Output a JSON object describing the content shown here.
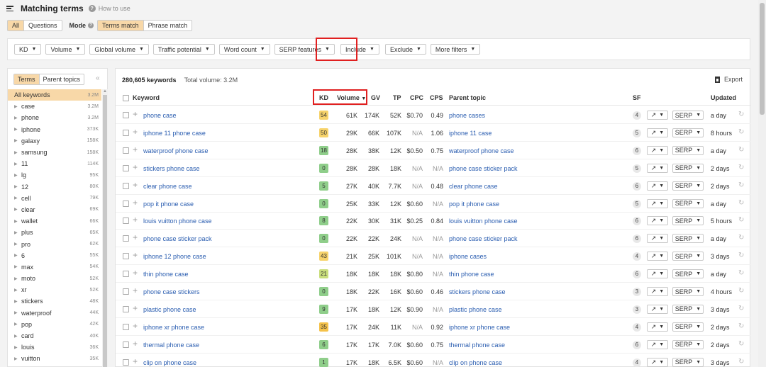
{
  "header": {
    "title": "Matching terms",
    "help_link": "How to use"
  },
  "mode_row": {
    "all": "All",
    "questions": "Questions",
    "mode_label": "Mode",
    "terms_match": "Terms match",
    "phrase_match": "Phrase match"
  },
  "filters": [
    "KD",
    "Volume",
    "Global volume",
    "Traffic potential",
    "Word count",
    "SERP features",
    "Include",
    "Exclude",
    "More filters"
  ],
  "sidebar": {
    "tab_terms": "Terms",
    "tab_parent": "Parent topics",
    "collapse": "«",
    "items": [
      {
        "kw": "All keywords",
        "vol": "3.2M"
      },
      {
        "kw": "case",
        "vol": "3.2M"
      },
      {
        "kw": "phone",
        "vol": "3.2M"
      },
      {
        "kw": "iphone",
        "vol": "373K"
      },
      {
        "kw": "galaxy",
        "vol": "158K"
      },
      {
        "kw": "samsung",
        "vol": "158K"
      },
      {
        "kw": "11",
        "vol": "114K"
      },
      {
        "kw": "lg",
        "vol": "95K"
      },
      {
        "kw": "12",
        "vol": "80K"
      },
      {
        "kw": "cell",
        "vol": "79K"
      },
      {
        "kw": "clear",
        "vol": "69K"
      },
      {
        "kw": "wallet",
        "vol": "66K"
      },
      {
        "kw": "plus",
        "vol": "65K"
      },
      {
        "kw": "pro",
        "vol": "62K"
      },
      {
        "kw": "6",
        "vol": "55K"
      },
      {
        "kw": "max",
        "vol": "54K"
      },
      {
        "kw": "moto",
        "vol": "52K"
      },
      {
        "kw": "xr",
        "vol": "52K"
      },
      {
        "kw": "stickers",
        "vol": "48K"
      },
      {
        "kw": "waterproof",
        "vol": "44K"
      },
      {
        "kw": "pop",
        "vol": "42K"
      },
      {
        "kw": "card",
        "vol": "40K"
      },
      {
        "kw": "louis",
        "vol": "36K"
      },
      {
        "kw": "vuitton",
        "vol": "35K"
      }
    ]
  },
  "summary": {
    "count": "280,605 keywords",
    "total": "Total volume: 3.2M",
    "export": "Export"
  },
  "columns": {
    "keyword": "Keyword",
    "kd": "KD",
    "volume": "Volume",
    "gv": "GV",
    "tp": "TP",
    "cpc": "CPC",
    "cps": "CPS",
    "parent": "Parent topic",
    "sf": "SF",
    "updated": "Updated"
  },
  "colors": {
    "kd_yellow": "#f7d36b",
    "kd_orange": "#f5c24a",
    "kd_green": "#8fce8a",
    "kd_lightgreen": "#c9de7c",
    "accent": "#f8d8a8",
    "highlight": "#e02020"
  },
  "rows": [
    {
      "kw": "phone case",
      "kd": "54",
      "kdc": "#f7d36b",
      "vol": "61K",
      "gv": "174K",
      "tp": "52K",
      "cpc": "$0.70",
      "cps": "0.49",
      "parent": "phone cases",
      "sf": "4",
      "serp": "SERP",
      "upd": "a day"
    },
    {
      "kw": "iphone 11 phone case",
      "kd": "50",
      "kdc": "#f7d36b",
      "vol": "29K",
      "gv": "66K",
      "tp": "107K",
      "cpc": "N/A",
      "cps": "1.06",
      "parent": "iphone 11 case",
      "sf": "5",
      "serp": "SERP",
      "upd": "8 hours"
    },
    {
      "kw": "waterproof phone case",
      "kd": "18",
      "kdc": "#8fce8a",
      "vol": "28K",
      "gv": "38K",
      "tp": "12K",
      "cpc": "$0.50",
      "cps": "0.75",
      "parent": "waterproof phone case",
      "sf": "6",
      "serp": "SERP",
      "upd": "a day"
    },
    {
      "kw": "stickers phone case",
      "kd": "0",
      "kdc": "#8fce8a",
      "vol": "28K",
      "gv": "28K",
      "tp": "18K",
      "cpc": "N/A",
      "cps": "N/A",
      "parent": "phone case sticker pack",
      "sf": "5",
      "serp": "SERP",
      "upd": "2 days"
    },
    {
      "kw": "clear phone case",
      "kd": "5",
      "kdc": "#8fce8a",
      "vol": "27K",
      "gv": "40K",
      "tp": "7.7K",
      "cpc": "N/A",
      "cps": "0.48",
      "parent": "clear phone case",
      "sf": "6",
      "serp": "SERP",
      "upd": "2 days"
    },
    {
      "kw": "pop it phone case",
      "kd": "0",
      "kdc": "#8fce8a",
      "vol": "25K",
      "gv": "33K",
      "tp": "12K",
      "cpc": "$0.60",
      "cps": "N/A",
      "parent": "pop it phone case",
      "sf": "5",
      "serp": "SERP",
      "upd": "a day"
    },
    {
      "kw": "louis vuitton phone case",
      "kd": "8",
      "kdc": "#8fce8a",
      "vol": "22K",
      "gv": "30K",
      "tp": "31K",
      "cpc": "$0.25",
      "cps": "0.84",
      "parent": "louis vuitton phone case",
      "sf": "6",
      "serp": "SERP",
      "upd": "5 hours"
    },
    {
      "kw": "phone case sticker pack",
      "kd": "0",
      "kdc": "#8fce8a",
      "vol": "22K",
      "gv": "22K",
      "tp": "24K",
      "cpc": "N/A",
      "cps": "N/A",
      "parent": "phone case sticker pack",
      "sf": "6",
      "serp": "SERP",
      "upd": "a day"
    },
    {
      "kw": "iphone 12 phone case",
      "kd": "43",
      "kdc": "#f7d36b",
      "vol": "21K",
      "gv": "25K",
      "tp": "101K",
      "cpc": "N/A",
      "cps": "N/A",
      "parent": "iphone cases",
      "sf": "4",
      "serp": "SERP",
      "upd": "3 days"
    },
    {
      "kw": "thin phone case",
      "kd": "21",
      "kdc": "#c9de7c",
      "vol": "18K",
      "gv": "18K",
      "tp": "18K",
      "cpc": "$0.80",
      "cps": "N/A",
      "parent": "thin phone case",
      "sf": "6",
      "serp": "SERP",
      "upd": "a day"
    },
    {
      "kw": "phone case stickers",
      "kd": "0",
      "kdc": "#8fce8a",
      "vol": "18K",
      "gv": "22K",
      "tp": "16K",
      "cpc": "$0.60",
      "cps": "0.46",
      "parent": "stickers phone case",
      "sf": "3",
      "serp": "SERP",
      "upd": "4 hours"
    },
    {
      "kw": "plastic phone case",
      "kd": "9",
      "kdc": "#8fce8a",
      "vol": "17K",
      "gv": "18K",
      "tp": "12K",
      "cpc": "$0.90",
      "cps": "N/A",
      "parent": "plastic phone case",
      "sf": "3",
      "serp": "SERP",
      "upd": "3 days"
    },
    {
      "kw": "iphone xr phone case",
      "kd": "35",
      "kdc": "#f5c24a",
      "vol": "17K",
      "gv": "24K",
      "tp": "11K",
      "cpc": "N/A",
      "cps": "0.92",
      "parent": "iphone xr phone case",
      "sf": "4",
      "serp": "SERP",
      "upd": "2 days"
    },
    {
      "kw": "thermal phone case",
      "kd": "6",
      "kdc": "#8fce8a",
      "vol": "17K",
      "gv": "17K",
      "tp": "7.0K",
      "cpc": "$0.60",
      "cps": "0.75",
      "parent": "thermal phone case",
      "sf": "6",
      "serp": "SERP",
      "upd": "2 days"
    },
    {
      "kw": "clip on phone case",
      "kd": "1",
      "kdc": "#8fce8a",
      "vol": "17K",
      "gv": "18K",
      "tp": "6.5K",
      "cpc": "$0.60",
      "cps": "N/A",
      "parent": "clip on phone case",
      "sf": "4",
      "serp": "SERP",
      "upd": "3 days"
    }
  ]
}
